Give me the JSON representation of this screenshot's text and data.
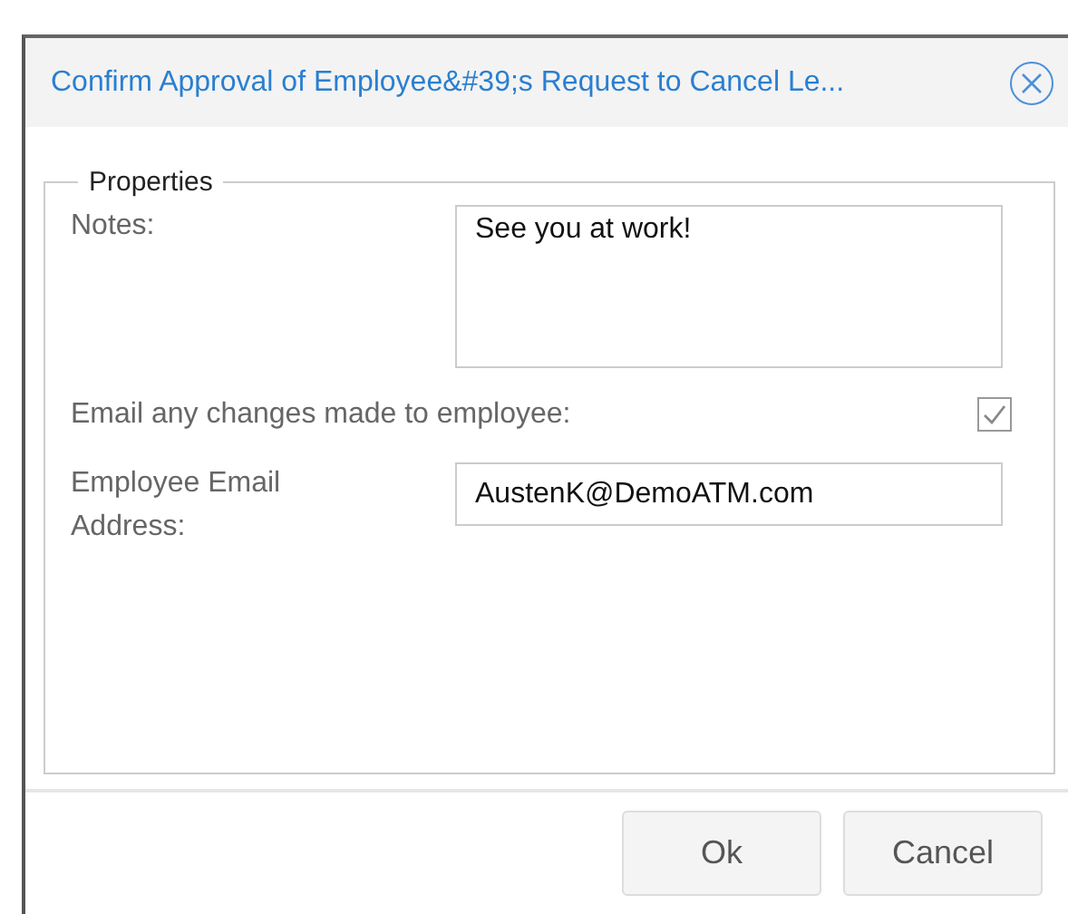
{
  "window": {
    "title": "Confirm Approval of Employee&#39;s Request to Cancel Le..."
  },
  "properties": {
    "legend": "Properties",
    "notes": {
      "label": "Notes:",
      "value": "See you at work!"
    },
    "email_changes": {
      "label": "Email any changes made to employee:",
      "checked": true
    },
    "email_address": {
      "label": "Employee Email Address:",
      "value": "AustenK@DemoATM.com"
    }
  },
  "buttons": [
    "Ok",
    "Cancel"
  ]
}
